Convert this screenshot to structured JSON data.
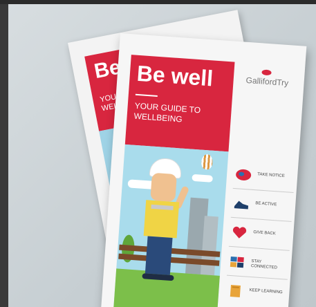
{
  "back": {
    "title": "Be w",
    "subtitle": "YOUR G WELLBEI"
  },
  "front": {
    "title": "Be well",
    "subtitle": "YOUR GUIDE TO WELLBEING",
    "logo": "GallifordTry",
    "items": [
      {
        "label": "TAKE NOTICE",
        "icon": "brain-icon",
        "color": "#d8263f"
      },
      {
        "label": "BE ACTIVE",
        "icon": "shoe-icon",
        "color": "#1e3f6a"
      },
      {
        "label": "GIVE BACK",
        "icon": "heart-icon",
        "color": "#d8263f"
      },
      {
        "label": "STAY CONNECTED",
        "icon": "puzzle-icon",
        "color": "#2a6fb0"
      },
      {
        "label": "KEEP LEARNING",
        "icon": "book-icon",
        "color": "#e8a43a"
      }
    ]
  }
}
